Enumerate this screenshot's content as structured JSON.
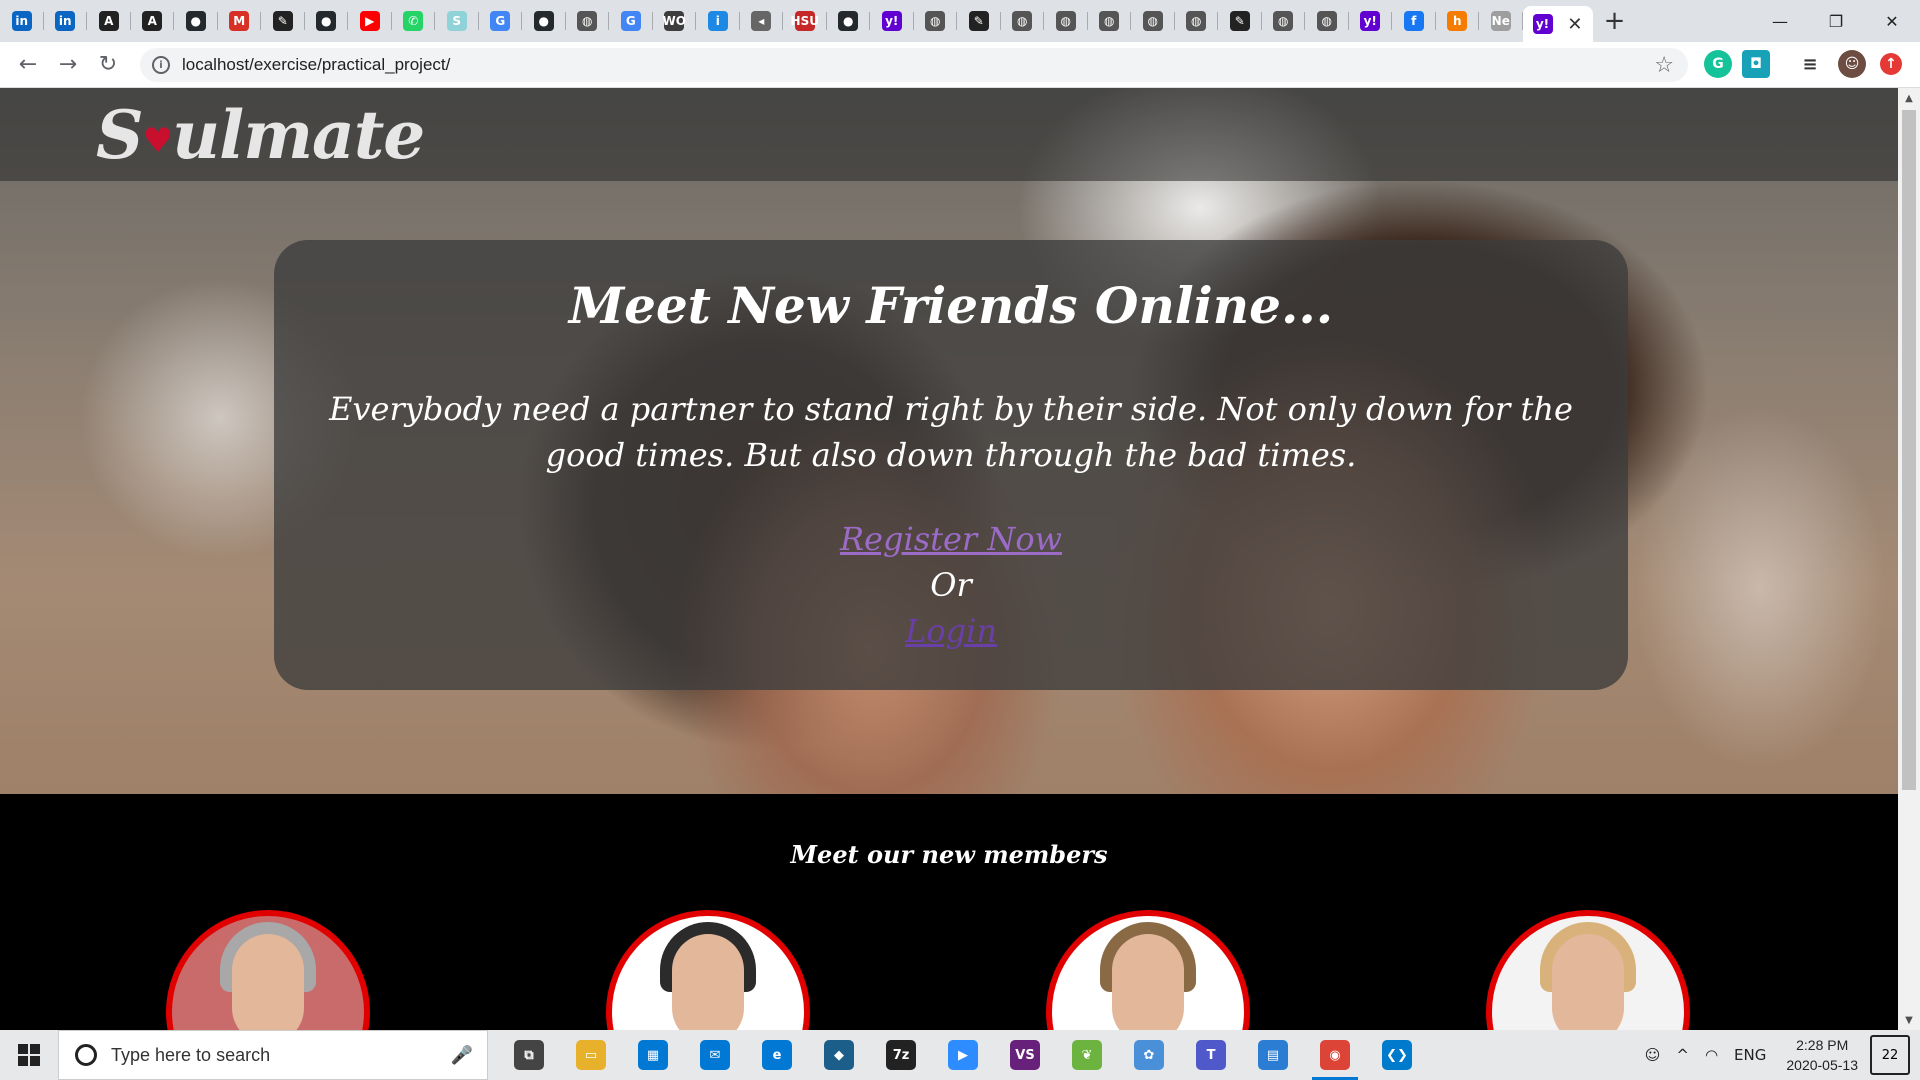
{
  "browser": {
    "tabs": [
      {
        "icon": "linkedin-icon",
        "glyph": "in",
        "color": "#0a66c2"
      },
      {
        "icon": "linkedin-icon",
        "glyph": "in",
        "color": "#0a66c2"
      },
      {
        "icon": "font-a-icon",
        "glyph": "A",
        "color": "#222222"
      },
      {
        "icon": "font-a-icon",
        "glyph": "A",
        "color": "#222222"
      },
      {
        "icon": "github-icon",
        "glyph": "●",
        "color": "#24292e"
      },
      {
        "icon": "gmail-icon",
        "glyph": "M",
        "color": "#d93025"
      },
      {
        "icon": "feather-icon",
        "glyph": "✎",
        "color": "#222222"
      },
      {
        "icon": "github-icon",
        "glyph": "●",
        "color": "#24292e"
      },
      {
        "icon": "youtube-icon",
        "glyph": "▶",
        "color": "#ff0000"
      },
      {
        "icon": "whatsapp-icon",
        "glyph": "✆",
        "color": "#25d366"
      },
      {
        "icon": "s-icon",
        "glyph": "S",
        "color": "#8fd3d9"
      },
      {
        "icon": "google-icon",
        "glyph": "G",
        "color": "#4285f4"
      },
      {
        "icon": "github-icon",
        "glyph": "●",
        "color": "#24292e"
      },
      {
        "icon": "globe-icon",
        "glyph": "◍",
        "color": "#555555"
      },
      {
        "icon": "google-icon",
        "glyph": "G",
        "color": "#4285f4"
      },
      {
        "icon": "wo-icon",
        "glyph": "WO",
        "color": "#3d3d3d"
      },
      {
        "icon": "info-icon",
        "glyph": "i",
        "color": "#1e88e5"
      },
      {
        "icon": "speaker-icon",
        "glyph": "◂",
        "color": "#666666"
      },
      {
        "icon": "hsu-icon",
        "glyph": "HSU",
        "color": "#c62828"
      },
      {
        "icon": "github-icon",
        "glyph": "●",
        "color": "#24292e"
      },
      {
        "icon": "yahoo-icon",
        "glyph": "y!",
        "color": "#6001d2"
      },
      {
        "icon": "globe-icon",
        "glyph": "◍",
        "color": "#555555"
      },
      {
        "icon": "feather-icon",
        "glyph": "✎",
        "color": "#222222"
      },
      {
        "icon": "globe-icon",
        "glyph": "◍",
        "color": "#555555"
      },
      {
        "icon": "globe-icon",
        "glyph": "◍",
        "color": "#555555"
      },
      {
        "icon": "globe-icon",
        "glyph": "◍",
        "color": "#555555"
      },
      {
        "icon": "globe-icon",
        "glyph": "◍",
        "color": "#555555"
      },
      {
        "icon": "globe-icon",
        "glyph": "◍",
        "color": "#555555"
      },
      {
        "icon": "feather-icon",
        "glyph": "✎",
        "color": "#222222"
      },
      {
        "icon": "globe-icon",
        "glyph": "◍",
        "color": "#555555"
      },
      {
        "icon": "globe-icon",
        "glyph": "◍",
        "color": "#555555"
      },
      {
        "icon": "yahoo-icon",
        "glyph": "y!",
        "color": "#6001d2"
      },
      {
        "icon": "facebook-icon",
        "glyph": "f",
        "color": "#1877f2"
      },
      {
        "icon": "h-icon",
        "glyph": "h",
        "color": "#f57c00"
      },
      {
        "icon": "new-tab-icon",
        "glyph": "Ne",
        "color": "#9e9e9e"
      }
    ],
    "active_tab": {
      "icon": "yahoo-icon",
      "glyph": "y!",
      "close": "✕"
    },
    "new_tab": "+",
    "window_controls": {
      "minimize": "—",
      "maximize": "❐",
      "close": "✕"
    },
    "nav": {
      "back": "←",
      "forward": "→",
      "reload": "↻"
    },
    "url": "localhost/exercise/practical_project/",
    "info_glyph": "i",
    "star": "☆"
  },
  "site": {
    "logo": {
      "before": "S",
      "heart": "♥",
      "after": "ulmate"
    },
    "hero": {
      "heading": "Meet New Friends Online...",
      "tagline": "Everybody need a partner to stand right by their side. Not only down for the good times. But also down through the bad times.",
      "register_link": "Register Now",
      "or_text": "Or",
      "login_link": "Login"
    },
    "members": {
      "title": "Meet our new members",
      "avatars": [
        {
          "name": "member-1",
          "hair": "#a8a8a8",
          "bg": "#c96b6b"
        },
        {
          "name": "member-2",
          "hair": "#2b2b2b",
          "bg": "#ffffff"
        },
        {
          "name": "member-3",
          "hair": "#8a6a45",
          "bg": "#ffffff"
        },
        {
          "name": "member-4",
          "hair": "#d8b27a",
          "bg": "#f3f3f3"
        }
      ]
    }
  },
  "taskbar": {
    "search_placeholder": "Type here to search",
    "mic": "🎤",
    "apps": [
      {
        "name": "task-view-icon",
        "glyph": "⧉",
        "color": "#444444"
      },
      {
        "name": "file-explorer-icon",
        "glyph": "▭",
        "color": "#e8b12c"
      },
      {
        "name": "store-icon",
        "glyph": "▦",
        "color": "#0078d4"
      },
      {
        "name": "mail-icon",
        "glyph": "✉",
        "color": "#0078d4"
      },
      {
        "name": "edge-icon",
        "glyph": "e",
        "color": "#0078d4"
      },
      {
        "name": "netbeans-icon",
        "glyph": "◆",
        "color": "#1b5e8a"
      },
      {
        "name": "7zip-icon",
        "glyph": "7z",
        "color": "#222222"
      },
      {
        "name": "zoom-icon",
        "glyph": "▶",
        "color": "#2d8cff"
      },
      {
        "name": "visual-studio-icon",
        "glyph": "VS",
        "color": "#68217a"
      },
      {
        "name": "spring-icon",
        "glyph": "❦",
        "color": "#6db33f"
      },
      {
        "name": "paint-icon",
        "glyph": "✿",
        "color": "#4a90d9"
      },
      {
        "name": "teams-icon",
        "glyph": "T",
        "color": "#5059c9"
      },
      {
        "name": "notepad-icon",
        "glyph": "▤",
        "color": "#2b7cd3"
      },
      {
        "name": "chrome-icon",
        "glyph": "◉",
        "color": "#db4437"
      },
      {
        "name": "vscode-icon",
        "glyph": "❮❯",
        "color": "#007acc"
      }
    ],
    "tray": {
      "people": "☺",
      "chevron": "^",
      "lang": "ENG",
      "time": "2:28 PM",
      "date": "2020-05-13",
      "notifications": "22"
    }
  }
}
